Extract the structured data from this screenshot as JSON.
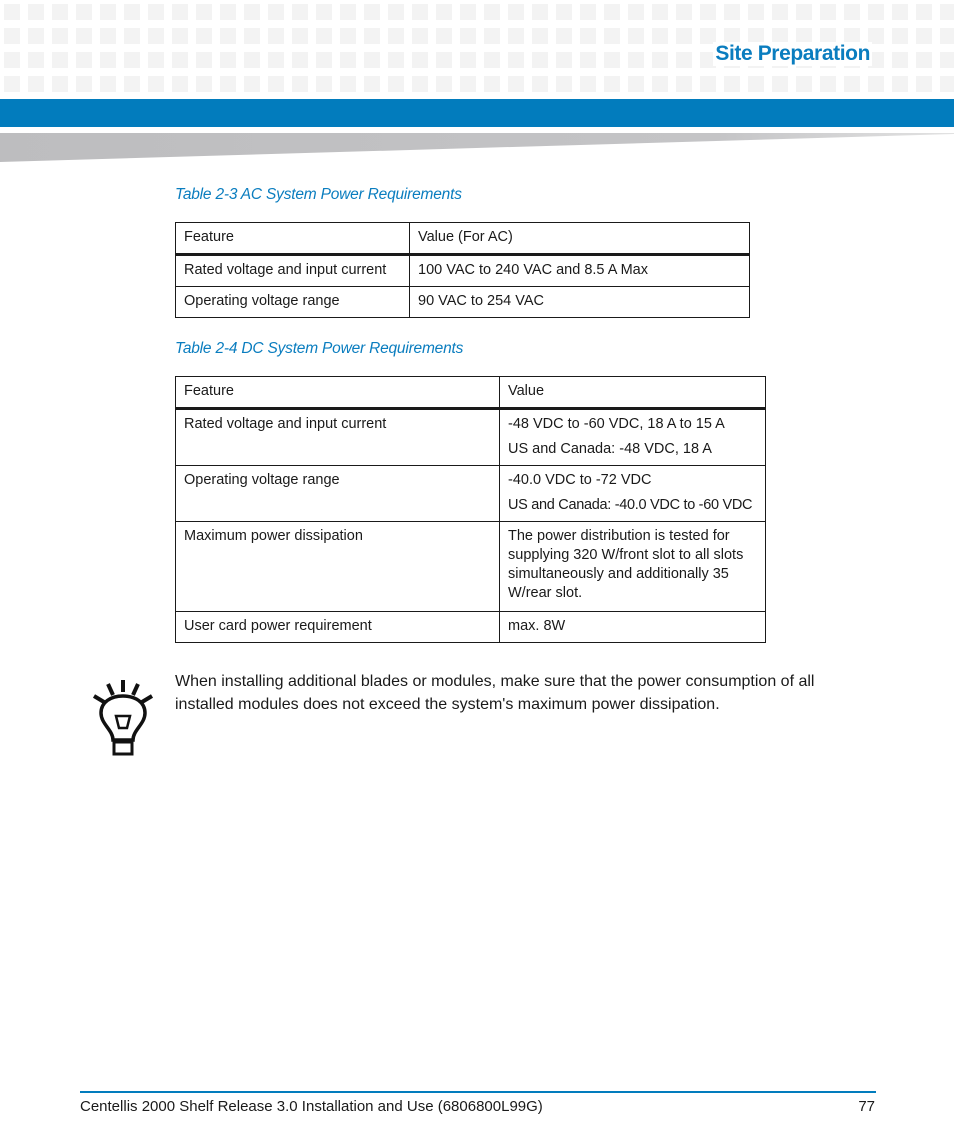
{
  "header": {
    "section_title": "Site Preparation",
    "accent_color": "#027cbd"
  },
  "tables": [
    {
      "caption": "Table 2-3 AC System Power Requirements",
      "columns": [
        "Feature",
        "Value (For AC)"
      ],
      "rows": [
        {
          "feature": "Rated voltage and input current",
          "values": [
            "100 VAC to 240 VAC and 8.5 A Max"
          ]
        },
        {
          "feature": "Operating voltage range",
          "values": [
            "90 VAC to 254 VAC"
          ]
        }
      ]
    },
    {
      "caption": "Table 2-4 DC System Power Requirements",
      "columns": [
        "Feature",
        "Value"
      ],
      "rows": [
        {
          "feature": "Rated voltage and input current",
          "values": [
            "-48 VDC to -60 VDC, 18 A to 15 A",
            "US and Canada: -48 VDC, 18 A"
          ]
        },
        {
          "feature": "Operating voltage range",
          "values": [
            "-40.0 VDC to -72 VDC",
            "US and Canada: -40.0 VDC to -60 VDC"
          ]
        },
        {
          "feature": "Maximum power dissipation",
          "values": [
            "The power distribution is tested for supplying 320 W/front slot to all slots simultaneously and additionally 35 W/rear slot."
          ]
        },
        {
          "feature": "User card power requirement",
          "values": [
            "max. 8W"
          ]
        }
      ]
    }
  ],
  "note": {
    "icon": "lightbulb-icon",
    "text": "When installing additional blades or modules, make sure that the power consumption of all installed modules does not exceed the system's maximum power dissipation."
  },
  "footer": {
    "document_title": "Centellis 2000 Shelf Release 3.0 Installation and Use (6806800L99G)",
    "page_number": "77"
  }
}
